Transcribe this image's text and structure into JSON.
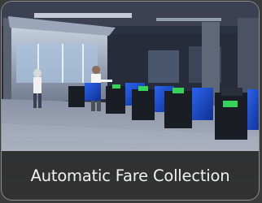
{
  "card": {
    "caption": "Automatic Fare Collection"
  },
  "image": {
    "subject": "metro-station-fare-gates",
    "gate_accent_color": "#1f4fd6",
    "gate_body_color": "#1a1d24",
    "gate_indicator_color": "#36d35a",
    "caption_bar_color": "#2a2a2a"
  }
}
